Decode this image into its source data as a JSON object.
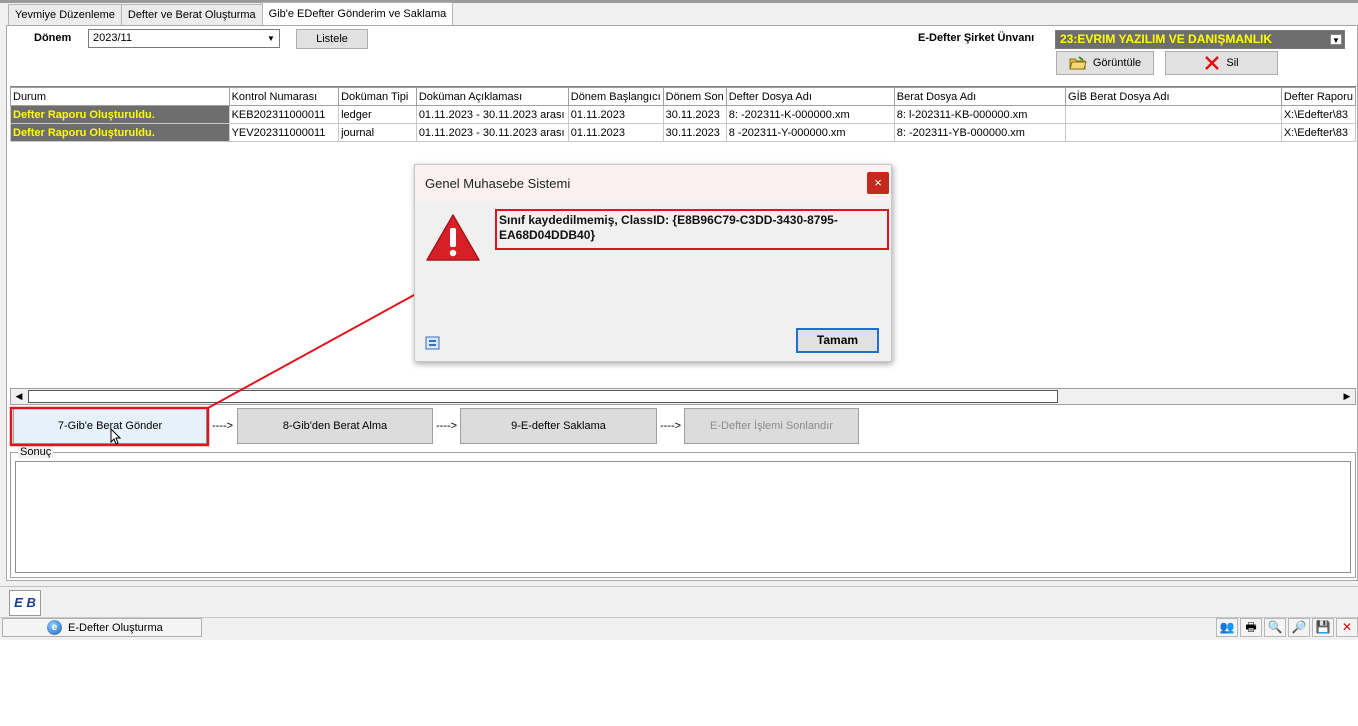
{
  "tabs": [
    "Yevmiye Düzenleme",
    "Defter ve Berat Oluşturma",
    "Gib'e EDefter Gönderim ve Saklama"
  ],
  "filters": {
    "donem_label": "Dönem",
    "donem_value": "2023/11",
    "listele_label": "Listele",
    "sirket_label": "E-Defter Şirket Ünvanı",
    "sirket_value": "23:EVRIM YAZILIM VE DANIŞMANLIK",
    "goruntule_label": "Görüntüle",
    "sil_label": "Sil"
  },
  "grid": {
    "columns": [
      "Durum",
      "Kontrol Numarası",
      "Doküman Tipi",
      "Doküman Açıklaması",
      "Dönem Başlangıcı",
      "Dönem Son",
      "Defter Dosya Adı",
      "Berat Dosya Adı",
      "GİB Berat Dosya Adı",
      "Defter Raporu"
    ],
    "rows": [
      [
        "Defter Raporu Oluşturuldu.",
        "KEB202311000011",
        "ledger",
        "01.11.2023 - 30.11.2023 arası",
        "01.11.2023",
        "30.11.2023",
        "8:                -202311-K-000000.xm",
        "8:              l-202311-KB-000000.xm",
        "",
        "X:\\Edefter\\83"
      ],
      [
        "Defter Raporu Oluşturuldu.",
        "YEV202311000011",
        "journal",
        "01.11.2023 - 30.11.2023 arası",
        "01.11.2023",
        "30.11.2023",
        "8                -202311-Y-000000.xm",
        "8:              -202311-YB-000000.xm",
        "",
        "X:\\Edefter\\83"
      ]
    ]
  },
  "steps": {
    "step7": "7-Gib'e Berat Gönder",
    "step8": "8-Gib'den Berat Alma",
    "step9": "9-E-defter Saklama",
    "step_end": "E-Defter İşlemi Sonlandır",
    "arrow": "---->"
  },
  "sonuc_label": "Sonuç",
  "taskbar": {
    "app_item": "E-Defter Oluşturma",
    "eb_logo": "E B"
  },
  "dialog": {
    "title": "Genel Muhasebe Sistemi",
    "close": "×",
    "message": "Sınıf kaydedilmemiş, ClassID: {E8B96C79-C3DD-3430-8795-EA68D04DDB40}",
    "ok_label": "Tamam"
  },
  "colors": {
    "highlight": "#e0141e",
    "durum_bg": "#6e6e6e",
    "durum_text": "#ffff00",
    "sirket_bg": "#6e6e6e"
  }
}
